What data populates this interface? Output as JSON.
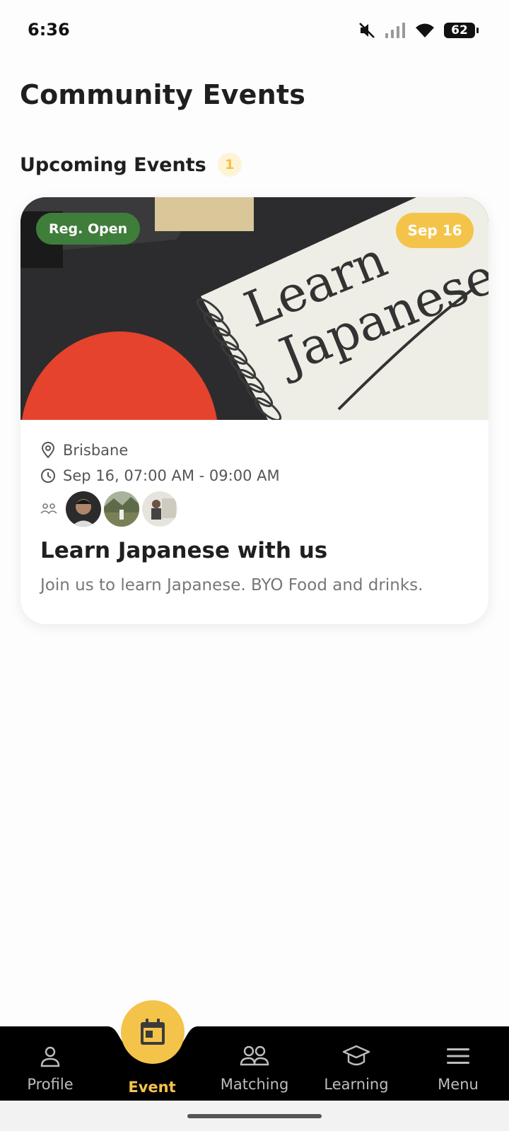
{
  "status_bar": {
    "time": "6:36",
    "battery": "62",
    "icons": [
      "mute-icon",
      "signal-icon",
      "wifi-icon",
      "battery-icon"
    ]
  },
  "page": {
    "title": "Community Events"
  },
  "section": {
    "title": "Upcoming Events",
    "count": "1"
  },
  "event": {
    "status_badge": "Reg. Open",
    "date_badge": "Sep 16",
    "image_text": "Learn Japanese",
    "location": "Brisbane",
    "time": "Sep 16, 07:00 AM - 09:00 AM",
    "title": "Learn Japanese with us",
    "description": "Join us to learn Japanese. BYO Food and drinks.",
    "attendees": [
      "avatar-1",
      "avatar-2",
      "avatar-3"
    ]
  },
  "nav": {
    "items": [
      {
        "label": "Profile",
        "icon": "person-icon"
      },
      {
        "label": "Event",
        "icon": "calendar-icon",
        "active": true
      },
      {
        "label": "Matching",
        "icon": "people-icon"
      },
      {
        "label": "Learning",
        "icon": "graduation-cap-icon"
      },
      {
        "label": "Menu",
        "icon": "menu-icon"
      }
    ]
  },
  "colors": {
    "accent": "#f4c44a",
    "reg_open": "#3f7d3b",
    "nav_bg": "#000000"
  }
}
